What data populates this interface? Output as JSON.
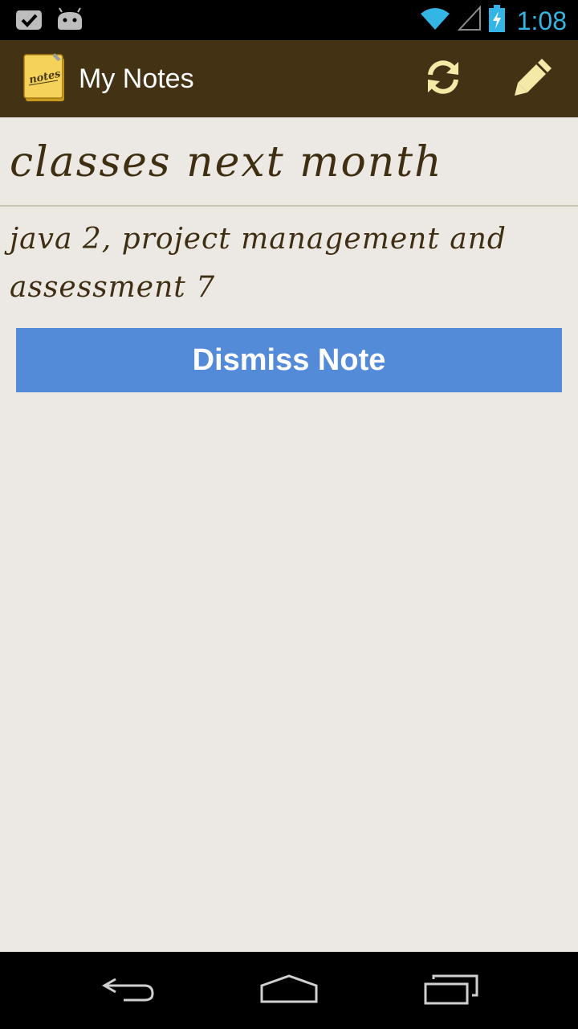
{
  "status_bar": {
    "time": "1:08",
    "icons": [
      "notification-check-icon",
      "android-icon",
      "wifi-icon",
      "signal-icon",
      "battery-charging-icon"
    ],
    "accent_color": "#33B5E5"
  },
  "action_bar": {
    "title": "My Notes",
    "app_icon": "notes-app-icon",
    "app_icon_text": "notes",
    "actions": [
      "refresh-icon",
      "edit-pencil-icon"
    ],
    "background_color": "#433314"
  },
  "note": {
    "title": "classes next month",
    "body": "java 2, project management and assessment 7"
  },
  "dismiss": {
    "label": "Dismiss Note",
    "color": "#548BD8"
  },
  "nav_bar": {
    "icons": [
      "back-icon",
      "home-icon",
      "recents-icon"
    ]
  }
}
